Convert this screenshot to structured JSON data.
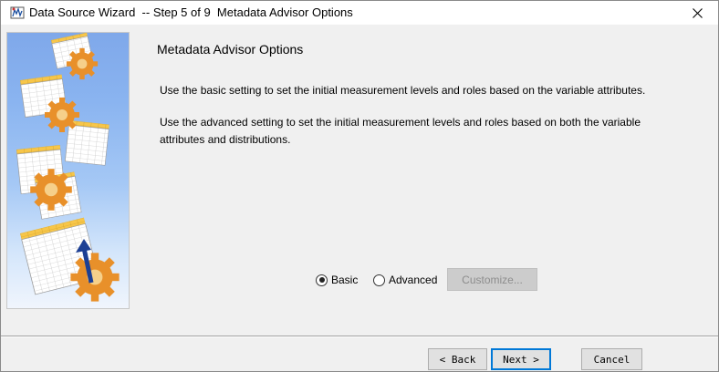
{
  "window": {
    "title": "Data Source Wizard  -- Step 5 of 9  Metadata Advisor Options",
    "close_icon": "close-icon"
  },
  "page": {
    "heading": "Metadata Advisor Options",
    "desc_basic": "Use the basic setting to set the initial measurement levels and roles based on the variable attributes.",
    "desc_advanced_line1": "Use the advanced setting to set the initial measurement levels and roles based on both the variable",
    "desc_advanced_line2": "attributes and distributions."
  },
  "options": {
    "basic_label": "Basic",
    "advanced_label": "Advanced",
    "selected": "Basic",
    "customize_label": "Customize..."
  },
  "buttons": {
    "back": "< Back",
    "next": "Next >",
    "cancel": "Cancel"
  },
  "colors": {
    "accent": "#0078d7",
    "art_blue": "#8ab4f0",
    "gear_orange": "#e8902a"
  }
}
